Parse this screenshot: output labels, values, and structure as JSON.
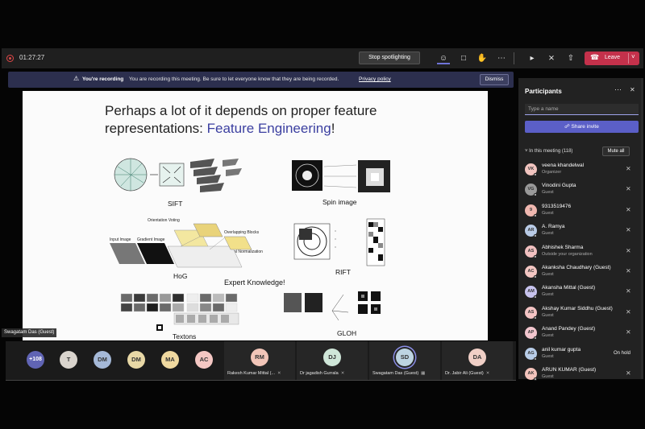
{
  "toolbar": {
    "timer": "01:27:27",
    "stop_spotlight": "Stop spotlighting",
    "leave": "Leave"
  },
  "banner": {
    "title": "You're recording",
    "message": "You are recording this meeting. Be sure to let everyone know that they are being recorded.",
    "policy_link": "Privacy policy",
    "dismiss": "Dismiss"
  },
  "slide": {
    "title_line1": "Perhaps a lot of it depends on proper feature",
    "title_line2_prefix": "representations: ",
    "title_highlight": "Feature Engineering",
    "title_suffix": "!",
    "labels": {
      "sift": "SIFT",
      "spin": "Spin image",
      "hog": "HoG",
      "rift": "RIFT",
      "expert": "Expert Knowledge!",
      "textons": "Textons",
      "gloh": "GLOH"
    },
    "hog_text": {
      "orientation": "Orientation Voting",
      "overlapping": "Overlapping Blocks",
      "input": "Input Image",
      "gradient": "Gradient Image",
      "local": "Local Normalization"
    }
  },
  "speaker_tag": "Swagatam Das (Guest)",
  "strip": {
    "overflow_count": "+108",
    "avatars": [
      "T",
      "DM",
      "DM",
      "MA",
      "AC"
    ],
    "tiles": [
      {
        "initials": "RM",
        "name": "Rakesh Kumar Mittal (..."
      },
      {
        "initials": "DJ",
        "name": "Dr jagadish Gurrala"
      },
      {
        "initials": "SD",
        "name": "Swagatam Das (Guest)"
      },
      {
        "initials": "DA",
        "name": "Dr. Jabir Ali (Guest)"
      }
    ]
  },
  "panel": {
    "title": "Participants",
    "search_placeholder": "Type a name",
    "share_invite": "Share invite",
    "in_meeting": "In this meeting (118)",
    "mute_all": "Mute all",
    "participants": [
      {
        "initials": "VK",
        "name": "veena khandelwal",
        "role": "Organizer",
        "color": "#f2c5c0",
        "status": ""
      },
      {
        "initials": "VG",
        "name": "Vinodini Gupta",
        "role": "Guest",
        "color": "#9a9a9a",
        "status": ""
      },
      {
        "initials": "9",
        "name": "9313519476",
        "role": "Guest",
        "color": "#f0b8b0",
        "status": ""
      },
      {
        "initials": "AR",
        "name": "A. Ramya",
        "role": "Guest",
        "color": "#b9cbe6",
        "status": ""
      },
      {
        "initials": "AS",
        "name": "Abhishek Sharma",
        "role": "Outside your organization",
        "color": "#f1c0c0",
        "status": ""
      },
      {
        "initials": "AC",
        "name": "Akanksha Chaudhary (Guest)",
        "role": "Guest",
        "color": "#f4c7c3",
        "status": ""
      },
      {
        "initials": "AM",
        "name": "Akansha Mittal (Guest)",
        "role": "Guest",
        "color": "#c7c3ee",
        "status": ""
      },
      {
        "initials": "AS",
        "name": "Akshay Kumar Siddhu (Guest)",
        "role": "Guest",
        "color": "#f4c4c4",
        "status": ""
      },
      {
        "initials": "AP",
        "name": "Anand Pandey (Guest)",
        "role": "Guest",
        "color": "#f2c6ce",
        "status": ""
      },
      {
        "initials": "AG",
        "name": "anil kumar gupta",
        "role": "Guest",
        "color": "#b8cde8",
        "status": "On hold"
      },
      {
        "initials": "AK",
        "name": "ARUN KUMAR (Guest)",
        "role": "Guest",
        "color": "#f4c4bc",
        "status": ""
      }
    ]
  }
}
